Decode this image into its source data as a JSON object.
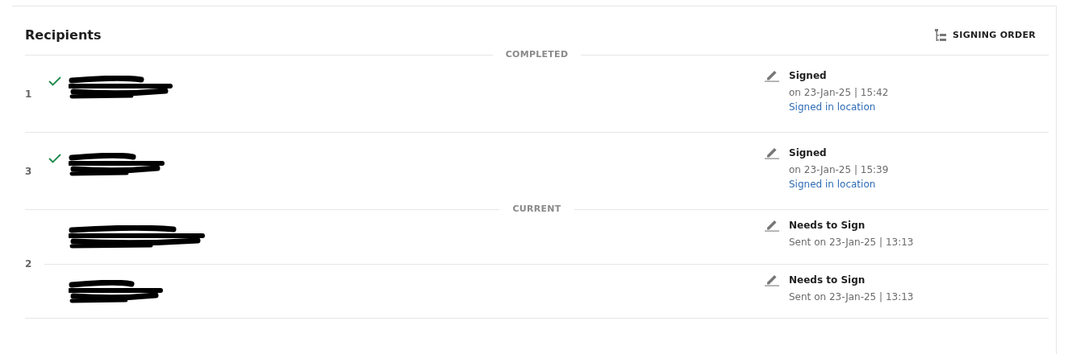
{
  "title": "Recipients",
  "signing_order_button": {
    "label": "SIGNING ORDER"
  },
  "sections": [
    {
      "label": "COMPLETED",
      "groups": [
        {
          "order": "1",
          "recipients": [
            {
              "completed": true,
              "status": "Signed",
              "detail": "on 23-Jan-25 | 15:42",
              "link": "Signed in location"
            }
          ]
        },
        {
          "order": "3",
          "recipients": [
            {
              "completed": true,
              "status": "Signed",
              "detail": "on 23-Jan-25 | 15:39",
              "link": "Signed in location"
            }
          ]
        }
      ]
    },
    {
      "label": "CURRENT",
      "groups": [
        {
          "order": "2",
          "recipients": [
            {
              "completed": false,
              "status": "Needs to Sign",
              "detail": "Sent on 23-Jan-25 | 13:13"
            },
            {
              "completed": false,
              "status": "Needs to Sign",
              "detail": "Sent on 23-Jan-25 | 13:13"
            }
          ]
        }
      ]
    }
  ]
}
